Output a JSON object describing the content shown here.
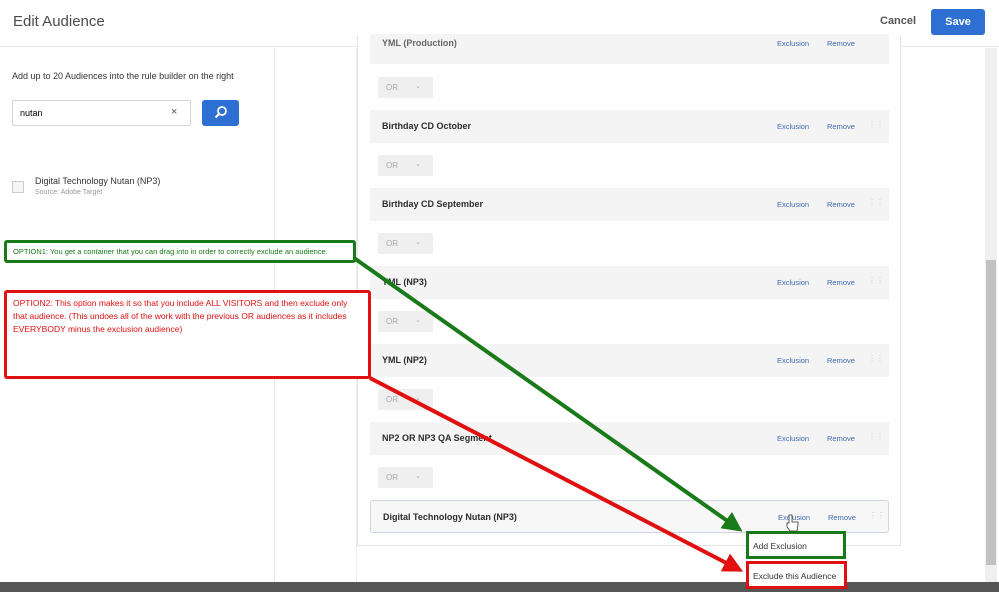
{
  "header": {
    "title": "Edit Audience",
    "cancel": "Cancel",
    "save": "Save"
  },
  "left": {
    "hint": "Add up to 20 Audiences into the rule builder on the right",
    "search_value": "nutan",
    "clear": "×",
    "results": [
      {
        "name": "Digital Technology Nutan (NP3)",
        "source": "Source: Adobe Target"
      }
    ]
  },
  "builder": {
    "top_row": "YML (Production)",
    "rows": [
      {
        "name": "Birthday CD October"
      },
      {
        "name": "Birthday CD September"
      },
      {
        "name": "YML (NP3)"
      },
      {
        "name": "YML (NP2)"
      },
      {
        "name": "NP2 OR NP3 QA Segment"
      },
      {
        "name": "Digital Technology Nutan (NP3)"
      }
    ],
    "exclusion": "Exclusion",
    "remove": "Remove",
    "operator": "OR",
    "drag": "⋮⋮"
  },
  "menu": {
    "add_exclusion": "Add Exclusion",
    "exclude_audience": "Exclude this Audience"
  },
  "annotations": {
    "option1": "OPTION1: You get a container that you can drag into in order to correctly exclude an audience.",
    "option2": "OPTION2: This option makes it so that you include ALL VISITORS and then exclude only that audience. (This undoes all of the work with the previous  OR audiences as it includes EVERYBODY minus the exclusion audience)"
  },
  "colors": {
    "accent": "#2d6fd2",
    "green": "#1a7a1a",
    "red": "#e01010"
  }
}
